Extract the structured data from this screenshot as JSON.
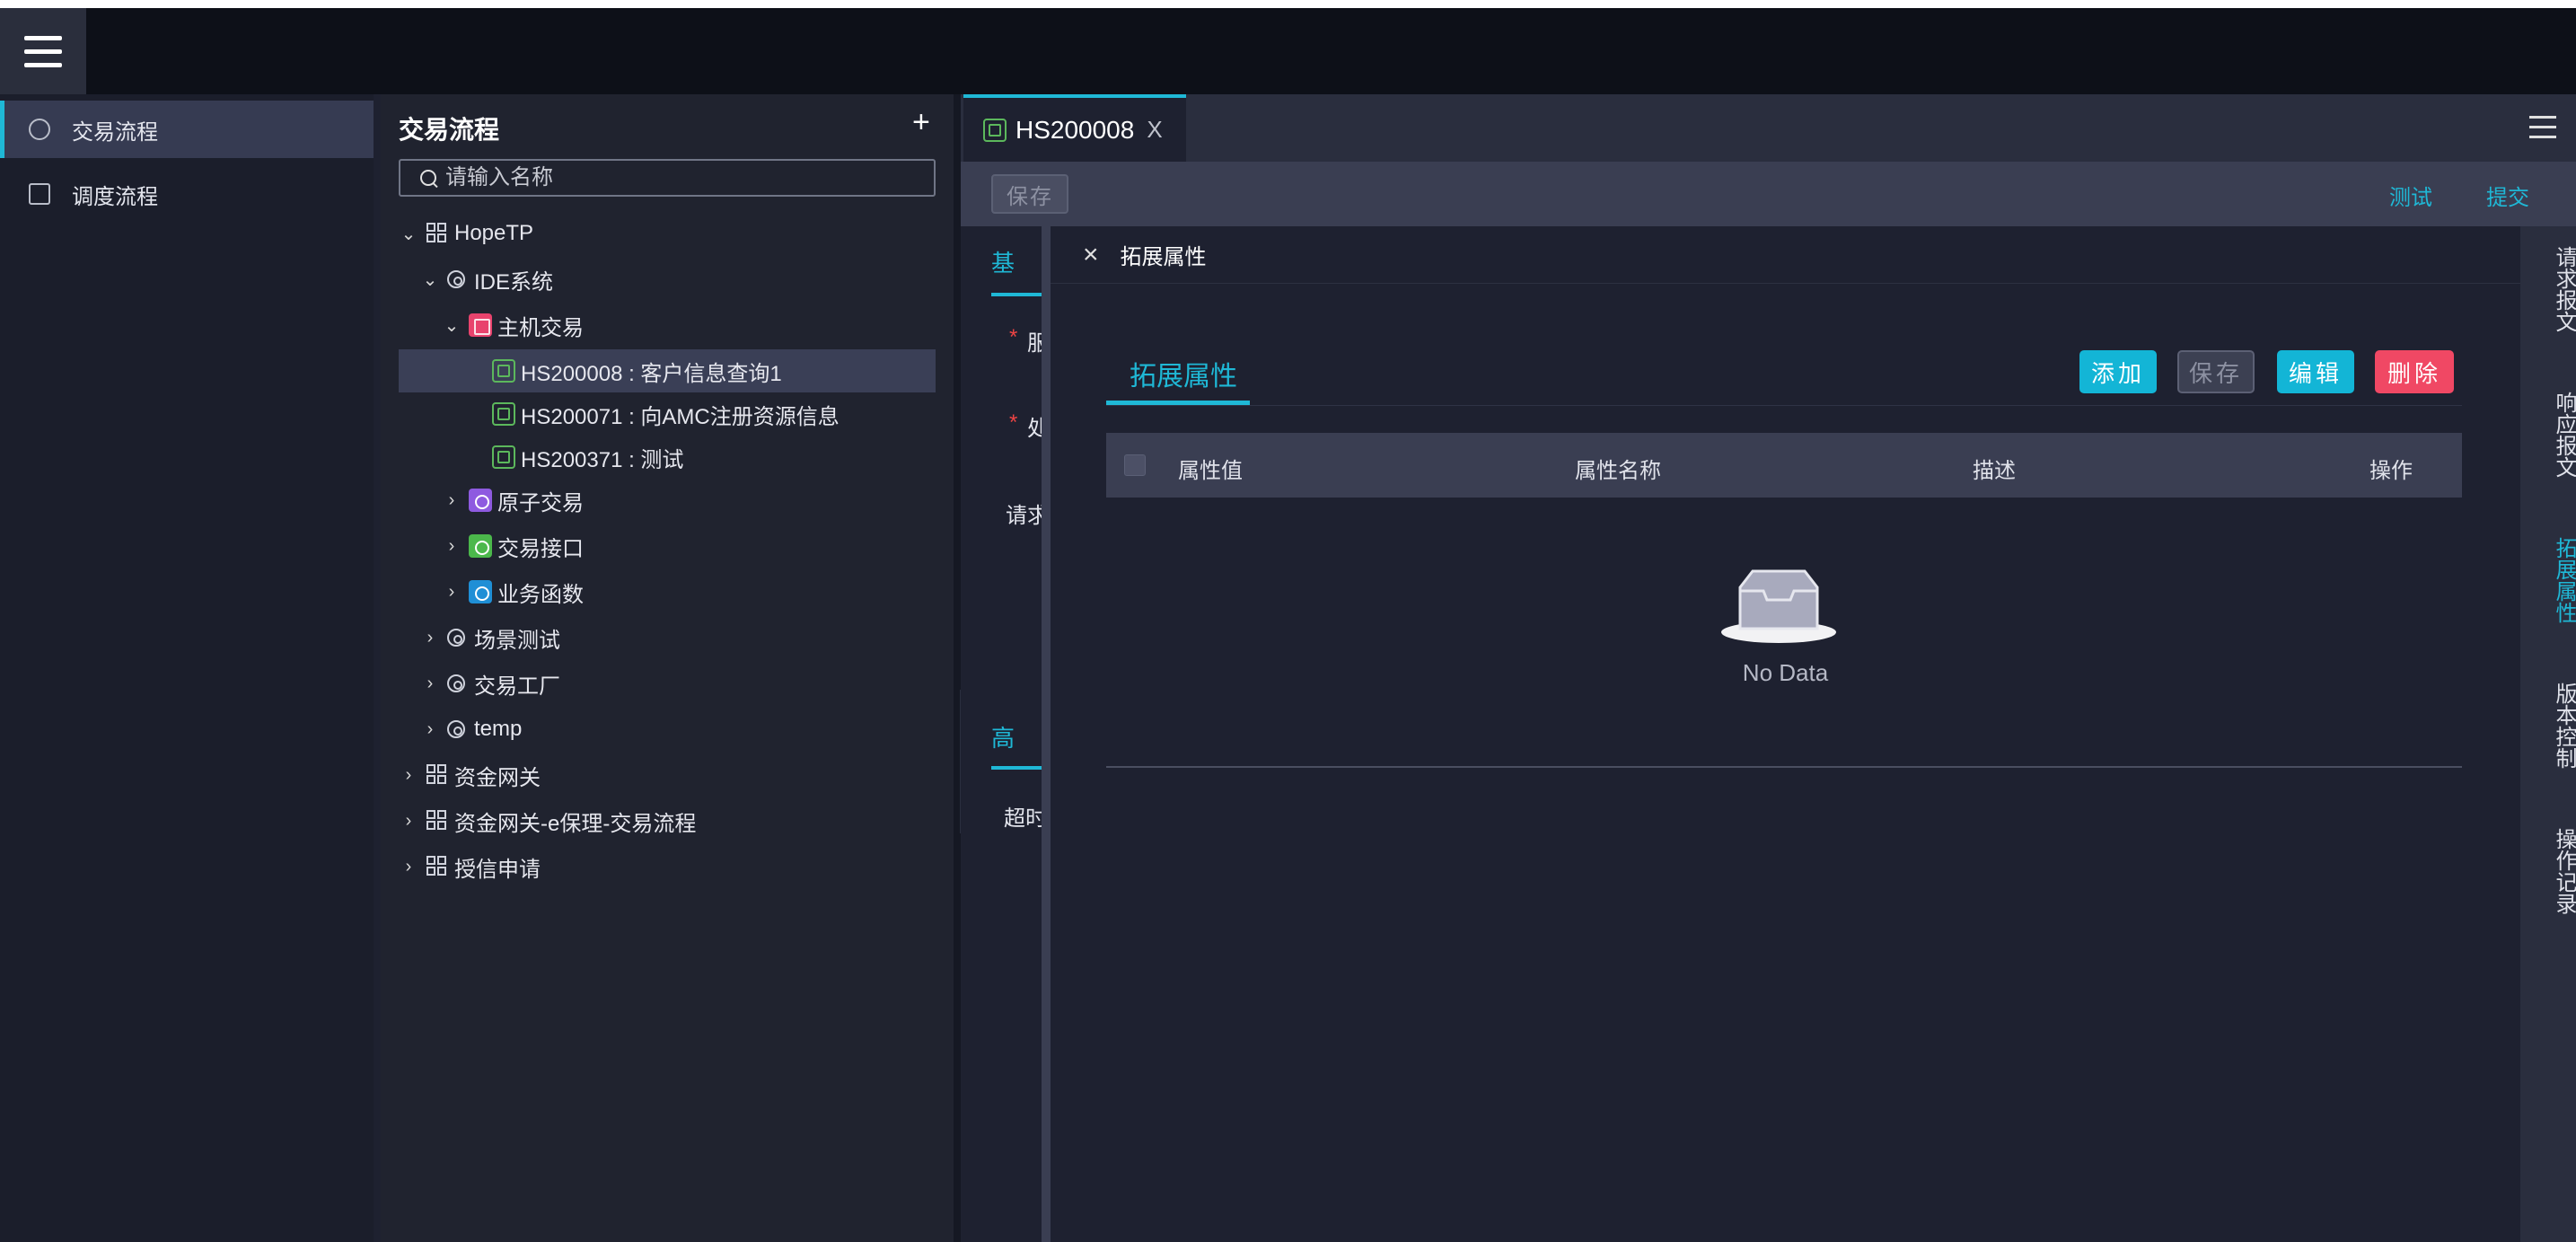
{
  "nav": {
    "items": [
      {
        "label": "交易流程",
        "icon": "transaction-flow-icon"
      },
      {
        "label": "调度流程",
        "icon": "schedule-flow-icon"
      }
    ]
  },
  "tree": {
    "title": "交易流程",
    "add_label": "+",
    "search_placeholder": "请输入名称",
    "nodes": [
      {
        "label": "HopeTP",
        "arrow": "⌄"
      },
      {
        "label": "IDE系统",
        "arrow": "⌄"
      },
      {
        "label": "主机交易",
        "arrow": "⌄"
      },
      {
        "label": "HS200008 : 客户信息查询1",
        "arrow": ""
      },
      {
        "label": "HS200071 : 向AMC注册资源信息",
        "arrow": ""
      },
      {
        "label": "HS200371 : 测试",
        "arrow": ""
      },
      {
        "label": "原子交易",
        "arrow": "›"
      },
      {
        "label": "交易接口",
        "arrow": "›"
      },
      {
        "label": "业务函数",
        "arrow": "›"
      },
      {
        "label": "场景测试",
        "arrow": "›"
      },
      {
        "label": "交易工厂",
        "arrow": "›"
      },
      {
        "label": "temp",
        "arrow": "›"
      },
      {
        "label": "资金网关",
        "arrow": "›"
      },
      {
        "label": "资金网关-e保理-交易流程",
        "arrow": "›"
      },
      {
        "label": "授信申请",
        "arrow": "›"
      }
    ]
  },
  "editor": {
    "tab_label": "HS200008",
    "tab_close": "X",
    "save_label": "保存",
    "test_label": "测试",
    "submit_label": "提交",
    "under": {
      "tab_basic": "基",
      "field1": "服",
      "field2": "处",
      "request": "请求",
      "tab_advanced": "高",
      "timeout": "超时",
      "required_mark": "*"
    }
  },
  "drawer": {
    "close": "×",
    "title": "拓展属性",
    "tab_label": "拓展属性",
    "buttons": {
      "add": "添加",
      "save": "保存",
      "edit": "编辑",
      "delete": "删除"
    },
    "columns": [
      "属性值",
      "属性名称",
      "描述",
      "操作"
    ],
    "empty_text": "No Data"
  },
  "right_tabs": [
    "请求报文",
    "响应报文",
    "拓展属性",
    "版本控制",
    "操作记录"
  ],
  "colors": {
    "accent": "#1fb8d6",
    "danger": "#f04864",
    "host_icon": "#e8436d",
    "atom_icon": "#8e5ae0",
    "iface_icon": "#4bb84b",
    "func_icon": "#1f8fd6"
  }
}
